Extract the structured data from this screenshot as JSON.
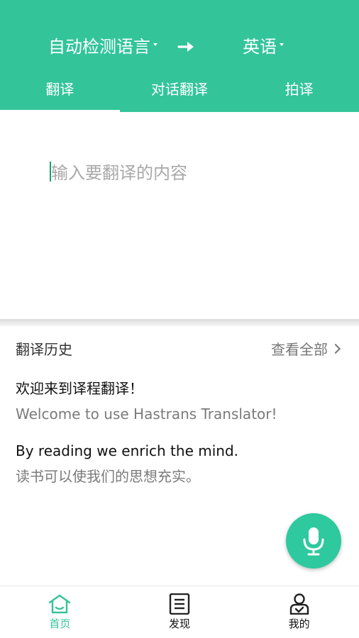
{
  "colors": {
    "accent": "#33c49a",
    "mic": "#2ec99e"
  },
  "header": {
    "source_lang": "自动检测语言",
    "target_lang": "英语",
    "swap_icon": "arrow-right-icon"
  },
  "tabs": [
    {
      "label": "翻译",
      "active": true
    },
    {
      "label": "对话翻译",
      "active": false
    },
    {
      "label": "拍译",
      "active": false
    }
  ],
  "input": {
    "placeholder": "输入要翻译的内容",
    "value": ""
  },
  "history": {
    "title": "翻译历史",
    "view_all": "查看全部",
    "entries": [
      {
        "source": "欢迎来到译程翻译！",
        "target": "Welcome to use Hastrans Translator!"
      },
      {
        "source": "By reading we enrich the mind.",
        "target": "读书可以使我们的思想充实。"
      }
    ]
  },
  "mic": {
    "icon": "microphone-icon"
  },
  "bottom_nav": [
    {
      "label": "首页",
      "icon": "home-icon",
      "active": true
    },
    {
      "label": "发现",
      "icon": "discover-icon",
      "active": false
    },
    {
      "label": "我的",
      "icon": "profile-icon",
      "active": false
    }
  ]
}
